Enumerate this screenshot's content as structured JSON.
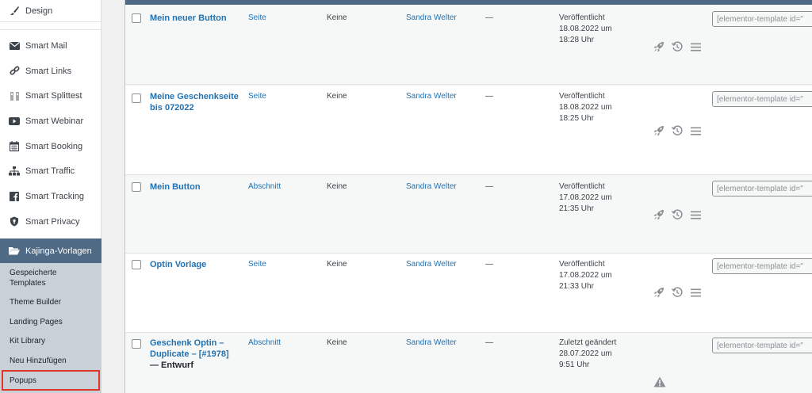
{
  "sidebar": {
    "design": {
      "label": "Design",
      "icon": "brush-icon"
    },
    "items": [
      {
        "label": "Smart Mail",
        "icon": "mail-icon"
      },
      {
        "label": "Smart Links",
        "icon": "link-icon"
      },
      {
        "label": "Smart Splittest",
        "icon": "splittest-icon"
      },
      {
        "label": "Smart Webinar",
        "icon": "video-icon"
      },
      {
        "label": "Smart Booking",
        "icon": "calendar-icon"
      },
      {
        "label": "Smart Traffic",
        "icon": "sitemap-icon"
      },
      {
        "label": "Smart Tracking",
        "icon": "facebook-icon"
      },
      {
        "label": "Smart Privacy",
        "icon": "shield-icon"
      }
    ],
    "active": {
      "label": "Kajinga-Vorlagen",
      "icon": "folder-open-icon"
    },
    "submenu": [
      {
        "label": "Gespeicherte Templates"
      },
      {
        "label": "Theme Builder"
      },
      {
        "label": "Landing Pages"
      },
      {
        "label": "Kit Library"
      },
      {
        "label": "Neu Hinzufügen"
      },
      {
        "label": "Popups"
      }
    ]
  },
  "rows": [
    {
      "title": "Mein neuer Button",
      "state": "",
      "type": "Seite",
      "keine": "Keine",
      "author": "Sandra Welter",
      "dash": "—",
      "date": [
        "Veröffentlicht",
        "18.08.2022 um",
        "18:28 Uhr"
      ],
      "shortcode": "[elementor-template id=\""
    },
    {
      "title": "Meine Geschenkseite bis 072022",
      "state": "",
      "type": "Seite",
      "keine": "Keine",
      "author": "Sandra Welter",
      "dash": "—",
      "date": [
        "Veröffentlicht",
        "18.08.2022 um",
        "18:25 Uhr"
      ],
      "shortcode": "[elementor-template id=\""
    },
    {
      "title": "Mein Button",
      "state": "",
      "type": "Abschnitt",
      "keine": "Keine",
      "author": "Sandra Welter",
      "dash": "—",
      "date": [
        "Veröffentlicht",
        "17.08.2022 um",
        "21:35 Uhr"
      ],
      "shortcode": "[elementor-template id=\""
    },
    {
      "title": "Optin Vorlage",
      "state": "",
      "type": "Seite",
      "keine": "Keine",
      "author": "Sandra Welter",
      "dash": "—",
      "date": [
        "Veröffentlicht",
        "17.08.2022 um",
        "21:33 Uhr"
      ],
      "shortcode": "[elementor-template id=\""
    },
    {
      "title": "Geschenk Optin – Duplicate – [#1978]",
      "state": "— Entwurf",
      "type": "Abschnitt",
      "keine": "Keine",
      "author": "Sandra Welter",
      "dash": "—",
      "date": [
        "Zuletzt geändert",
        "28.07.2022 um",
        "9:51 Uhr"
      ],
      "shortcode": "[elementor-template id=\""
    }
  ],
  "colors": {
    "accent": "#2271b1",
    "menu_active": "#4f6a85",
    "submenu_bg": "#c9d0d8",
    "highlight_border": "#e0362a"
  }
}
